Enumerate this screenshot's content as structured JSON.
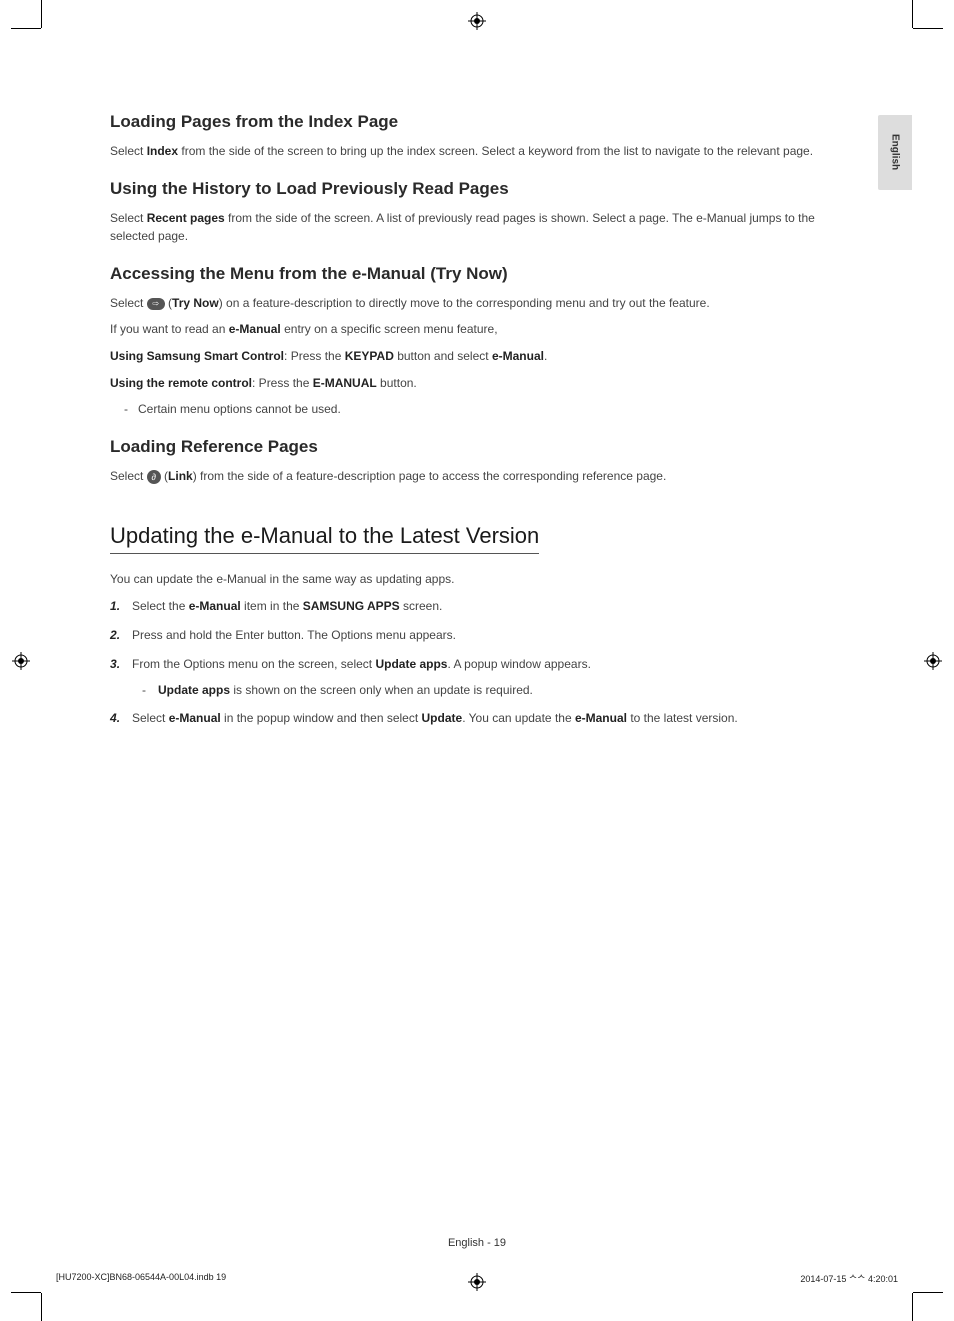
{
  "language_tab": "English",
  "sections": {
    "s1": {
      "heading": "Loading Pages from the Index Page",
      "p1_a": "Select ",
      "p1_b": "Index",
      "p1_c": " from the side of the screen to bring up the index screen. Select a keyword from the list to navigate to the relevant page."
    },
    "s2": {
      "heading": "Using the History to Load Previously Read Pages",
      "p1_a": "Select ",
      "p1_b": "Recent pages",
      "p1_c": " from the side of the screen. A list of previously read pages is shown. Select a page. The e-Manual jumps to the selected page."
    },
    "s3": {
      "heading": "Accessing the Menu from the e-Manual (Try Now)",
      "p1_a": "Select ",
      "p1_b": " (",
      "p1_c": "Try Now",
      "p1_d": ") on a feature-description to directly move to the corresponding menu and try out the feature.",
      "p2_a": "If you want to read an ",
      "p2_b": "e-Manual",
      "p2_c": " entry on a specific screen menu feature,",
      "p3_a": "Using Samsung Smart Control",
      "p3_b": ": Press the ",
      "p3_c": "KEYPAD",
      "p3_d": " button and select ",
      "p3_e": "e-Manual",
      "p3_f": ".",
      "p4_a": "Using the remote control",
      "p4_b": ": Press the ",
      "p4_c": "E-MANUAL",
      "p4_d": " button.",
      "note": "Certain menu options cannot be used."
    },
    "s4": {
      "heading": "Loading Reference Pages",
      "p1_a": "Select ",
      "p1_b": " (",
      "p1_c": "Link",
      "p1_d": ") from the side of a feature-description page to access the corresponding reference page."
    },
    "s5": {
      "heading": "Updating the e-Manual to the Latest Version",
      "p1": "You can update the e-Manual in the same way as updating apps.",
      "li1_a": "Select the ",
      "li1_b": "e-Manual",
      "li1_c": " item in the ",
      "li1_d": "SAMSUNG APPS",
      "li1_e": " screen.",
      "li2": "Press and hold the Enter button. The Options menu appears.",
      "li3_a": "From the Options menu on the screen, select ",
      "li3_b": "Update apps",
      "li3_c": ". A popup window appears.",
      "li3_note_a": "Update apps",
      "li3_note_b": " is shown on the screen only when an update is required.",
      "li4_a": "Select ",
      "li4_b": "e-Manual",
      "li4_c": " in the popup window and then select ",
      "li4_d": "Update",
      "li4_e": ". You can update the ",
      "li4_f": "e-Manual",
      "li4_g": " to the latest version."
    }
  },
  "footer": {
    "page_label": "English - 19",
    "file_ref": "[HU7200-XC]BN68-06544A-00L04.indb   19",
    "timestamp": "2014-07-15   ᄉᄉ 4:20:01"
  }
}
